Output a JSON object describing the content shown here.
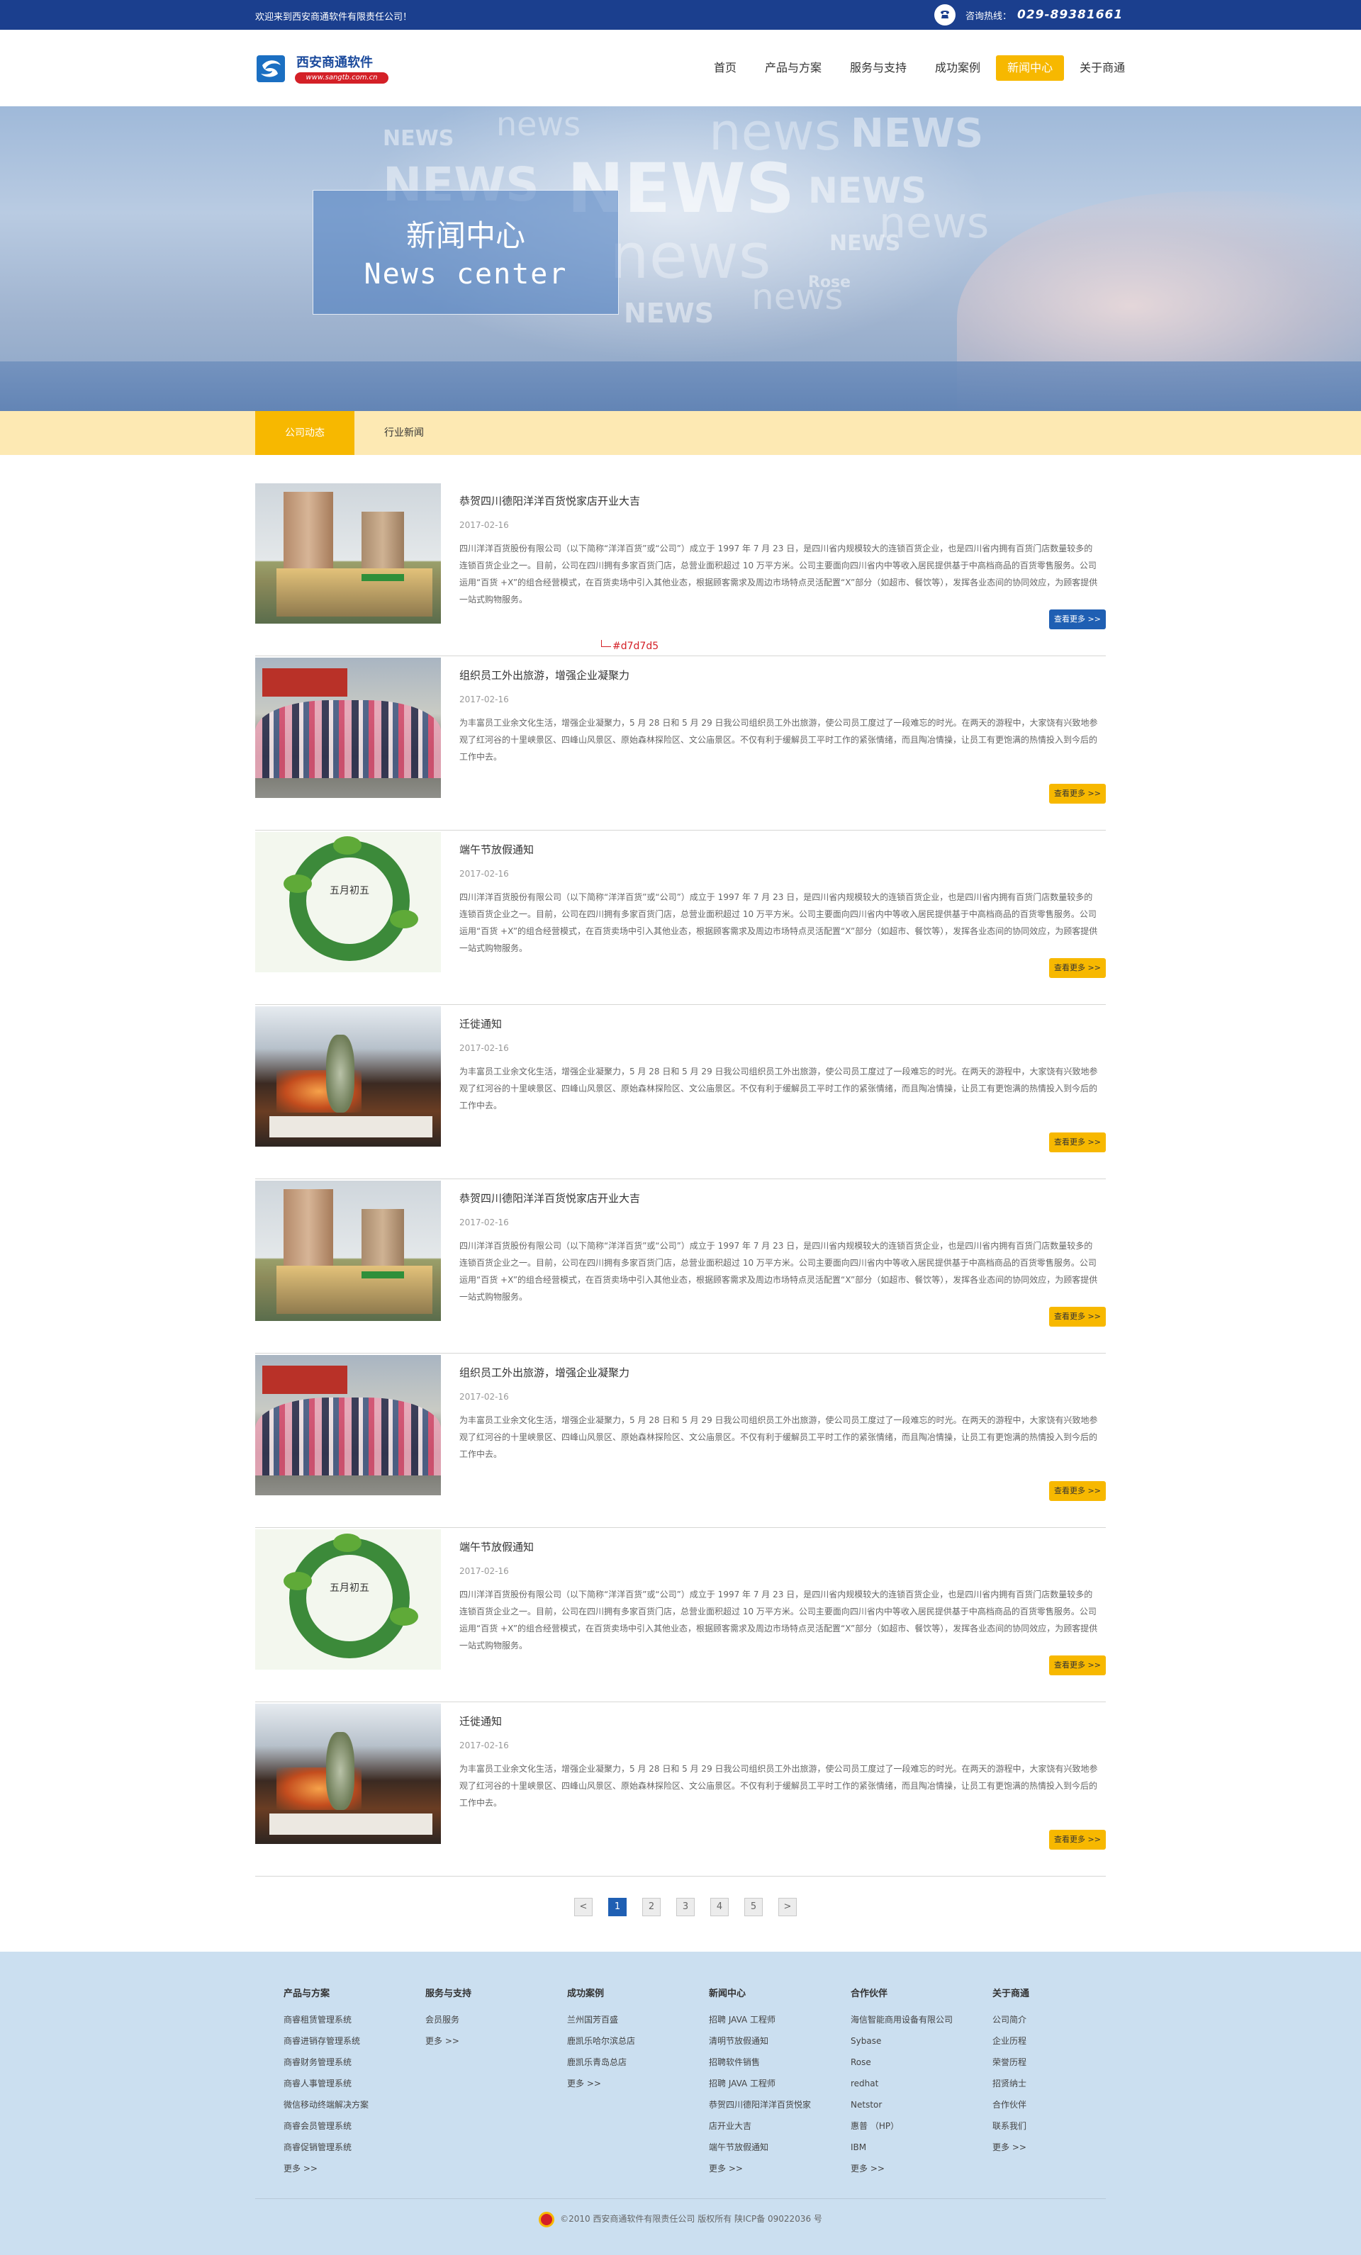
{
  "topbar": {
    "welcome": "欢迎来到西安商通软件有限责任公司！",
    "hotline_label": "咨询热线：",
    "hotline_number": "029-89381661"
  },
  "header": {
    "logo_name": "西安商通软件",
    "logo_url": "www.sangtb.com.cn",
    "nav": [
      {
        "label": "首页"
      },
      {
        "label": "产品与方案"
      },
      {
        "label": "服务与支持"
      },
      {
        "label": "成功案例"
      },
      {
        "label": "新闻中心"
      },
      {
        "label": "关于商通"
      }
    ],
    "active_nav": "新闻中心"
  },
  "banner": {
    "title_cn": "新闻中心",
    "title_en": "News center",
    "bg_words": [
      "NEWS",
      "news",
      "NEWS",
      "news",
      "NEWS",
      "NEWS",
      "news",
      "news",
      "NEWS",
      "news",
      "NEWS",
      "Rose",
      "NEWS"
    ]
  },
  "subtabs": [
    "公司动态",
    "行业新闻"
  ],
  "annotation": "#d7d7d5",
  "news": [
    {
      "title": "恭贺四川德阳洋洋百货悦家店开业大吉",
      "date": "2017-02-16",
      "summary": "四川洋洋百货股份有限公司（以下简称“洋洋百货”或“公司”）成立于 1997 年 7 月 23 日，是四川省内规模较大的连锁百货企业，也是四川省内拥有百货门店数量较多的连锁百货企业之一。目前，公司在四川拥有多家百货门店，总营业面积超过 10 万平方米。公司主要面向四川省内中等收入居民提供基于中高档商品的百货零售服务。公司运用“百货 +X”的组合经营模式，在百货卖场中引入其他业态，根据顾客需求及周边市场特点灵活配置“X”部分（如超市、餐饮等），发挥各业态间的协同效应，为顾客提供一站式购物服务。",
      "more": "查看更多 >>"
    },
    {
      "title": "组织员工外出旅游，增强企业凝聚力",
      "date": "2017-02-16",
      "summary": "为丰富员工业余文化生活，增强企业凝聚力，5 月 28 日和 5 月 29 日我公司组织员工外出旅游，使公司员工度过了一段难忘的时光。在两天的游程中，大家饶有兴致地参观了红河谷的十里峡景区、四峰山风景区、原始森林探险区、文公庙景区。不仅有利于缓解员工平时工作的紧张情绪，而且陶冶情操，让员工有更饱满的热情投入到今后的工作中去。",
      "more": "查看更多 >>"
    },
    {
      "title": "端午节放假通知",
      "date": "2017-02-16",
      "summary": "四川洋洋百货股份有限公司（以下简称“洋洋百货”或“公司”）成立于 1997 年 7 月 23 日，是四川省内规模较大的连锁百货企业，也是四川省内拥有百货门店数量较多的连锁百货企业之一。目前，公司在四川拥有多家百货门店，总营业面积超过 10 万平方米。公司主要面向四川省内中等收入居民提供基于中高档商品的百货零售服务。公司运用“百货 +X”的组合经营模式，在百货卖场中引入其他业态，根据顾客需求及周边市场特点灵活配置“X”部分（如超市、餐饮等），发挥各业态间的协同效应，为顾客提供一站式购物服务。",
      "more": "查看更多 >>",
      "image_text": "五月初五"
    },
    {
      "title": "迁徙通知",
      "date": "2017-02-16",
      "summary": "为丰富员工业余文化生活，增强企业凝聚力，5 月 28 日和 5 月 29 日我公司组织员工外出旅游，使公司员工度过了一段难忘的时光。在两天的游程中，大家饶有兴致地参观了红河谷的十里峡景区、四峰山风景区、原始森林探险区、文公庙景区。不仅有利于缓解员工平时工作的紧张情绪，而且陶冶情操，让员工有更饱满的热情投入到今后的工作中去。",
      "more": "查看更多 >>"
    },
    {
      "title": "恭贺四川德阳洋洋百货悦家店开业大吉",
      "date": "2017-02-16",
      "summary": "四川洋洋百货股份有限公司（以下简称“洋洋百货”或“公司”）成立于 1997 年 7 月 23 日，是四川省内规模较大的连锁百货企业，也是四川省内拥有百货门店数量较多的连锁百货企业之一。目前，公司在四川拥有多家百货门店，总营业面积超过 10 万平方米。公司主要面向四川省内中等收入居民提供基于中高档商品的百货零售服务。公司运用“百货 +X”的组合经营模式，在百货卖场中引入其他业态，根据顾客需求及周边市场特点灵活配置“X”部分（如超市、餐饮等），发挥各业态间的协同效应，为顾客提供一站式购物服务。",
      "more": "查看更多 >>"
    },
    {
      "title": "组织员工外出旅游，增强企业凝聚力",
      "date": "2017-02-16",
      "summary": "为丰富员工业余文化生活，增强企业凝聚力，5 月 28 日和 5 月 29 日我公司组织员工外出旅游，使公司员工度过了一段难忘的时光。在两天的游程中，大家饶有兴致地参观了红河谷的十里峡景区、四峰山风景区、原始森林探险区、文公庙景区。不仅有利于缓解员工平时工作的紧张情绪，而且陶冶情操，让员工有更饱满的热情投入到今后的工作中去。",
      "more": "查看更多 >>"
    },
    {
      "title": "端午节放假通知",
      "date": "2017-02-16",
      "summary": "四川洋洋百货股份有限公司（以下简称“洋洋百货”或“公司”）成立于 1997 年 7 月 23 日，是四川省内规模较大的连锁百货企业，也是四川省内拥有百货门店数量较多的连锁百货企业之一。目前，公司在四川拥有多家百货门店，总营业面积超过 10 万平方米。公司主要面向四川省内中等收入居民提供基于中高档商品的百货零售服务。公司运用“百货 +X”的组合经营模式，在百货卖场中引入其他业态，根据顾客需求及周边市场特点灵活配置“X”部分（如超市、餐饮等），发挥各业态间的协同效应，为顾客提供一站式购物服务。",
      "more": "查看更多 >>",
      "image_text": "五月初五"
    },
    {
      "title": "迁徙通知",
      "date": "2017-02-16",
      "summary": "为丰富员工业余文化生活，增强企业凝聚力，5 月 28 日和 5 月 29 日我公司组织员工外出旅游，使公司员工度过了一段难忘的时光。在两天的游程中，大家饶有兴致地参观了红河谷的十里峡景区、四峰山风景区、原始森林探险区、文公庙景区。不仅有利于缓解员工平时工作的紧张情绪，而且陶冶情操，让员工有更饱满的热情投入到今后的工作中去。",
      "more": "查看更多 >>"
    }
  ],
  "pagination": {
    "prev": "<",
    "pages": [
      "1",
      "2",
      "3",
      "4",
      "5"
    ],
    "current": "1",
    "next": ">"
  },
  "footer": {
    "columns": [
      {
        "title": "产品与方案",
        "links": [
          "商睿租赁管理系统",
          "商睿进销存管理系统",
          "商睿财务管理系统",
          "商睿人事管理系统",
          "微信移动终端解决方案",
          "商睿会员管理系统",
          "商睿促销管理系统",
          "更多 >>"
        ]
      },
      {
        "title": "服务与支持",
        "links": [
          "会员服务",
          "更多 >>"
        ]
      },
      {
        "title": "成功案例",
        "links": [
          "兰州国芳百盛",
          "鹿凯乐哈尔滨总店",
          "鹿凯乐青岛总店",
          "更多 >>"
        ]
      },
      {
        "title": "新闻中心",
        "links": [
          "招聘 JAVA 工程师",
          "清明节放假通知",
          "招聘软件销售",
          "招聘 JAVA 工程师",
          "恭贺四川德阳洋洋百货悦家",
          "店开业大吉",
          "端午节放假通知",
          "更多 >>"
        ]
      },
      {
        "title": "合作伙伴",
        "links": [
          "海信智能商用设备有限公司",
          "Sybase",
          "Rose",
          "redhat",
          "Netstor",
          "惠普 （HP）",
          "IBM",
          "更多 >>"
        ]
      },
      {
        "title": "关于商通",
        "links": [
          "公司简介",
          "企业历程",
          "荣誉历程",
          "招贤纳士",
          "合作伙伴",
          "联系我们",
          "更多 >>"
        ]
      }
    ],
    "copyright": "©2010 西安商通软件有限责任公司 版权所有 陕ICP备 09022036 号"
  },
  "colors": {
    "topbar": "#1b3f8e",
    "accent_yellow": "#f7b800",
    "more_blue": "#1f5fb3",
    "subtab_bg": "#fde9b3",
    "footer_bg": "#cbdff0",
    "divider": "#d7d7d5"
  },
  "icons": {
    "phone": "phone-icon",
    "prev": "chevron-left-icon",
    "next": "chevron-right-icon",
    "badge": "police-badge-icon"
  }
}
